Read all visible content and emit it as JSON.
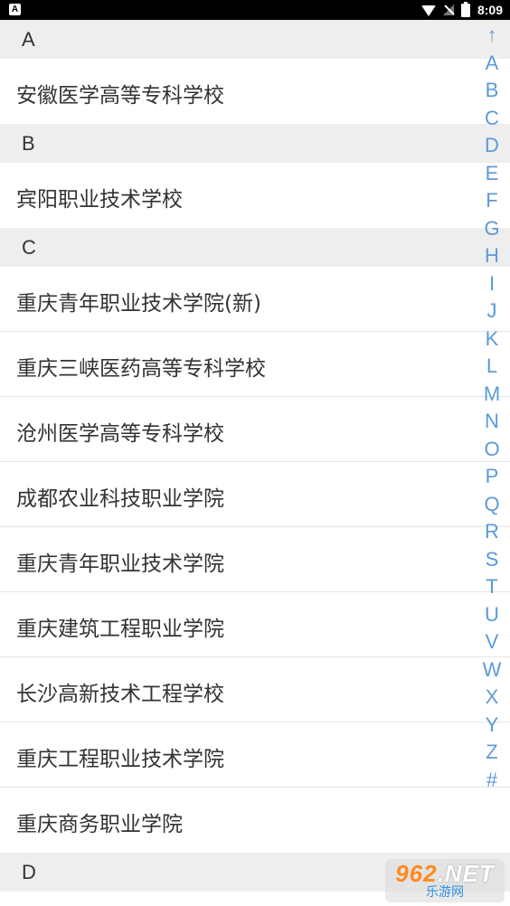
{
  "status_bar": {
    "notification_badge": "A",
    "time": "8:09",
    "icons": [
      "wifi-icon",
      "signal-off-icon",
      "battery-charging-icon"
    ]
  },
  "sections": [
    {
      "letter": "A",
      "items": [
        "安徽医学高等专科学校"
      ]
    },
    {
      "letter": "B",
      "items": [
        "宾阳职业技术学校"
      ]
    },
    {
      "letter": "C",
      "items": [
        "重庆青年职业技术学院(新)",
        "重庆三峡医药高等专科学校",
        "沧州医学高等专科学校",
        "成都农业科技职业学院",
        "重庆青年职业技术学院",
        "重庆建筑工程职业学院",
        "长沙高新技术工程学校",
        "重庆工程职业技术学院",
        "重庆商务职业学院"
      ]
    },
    {
      "letter": "D",
      "items": []
    }
  ],
  "index_bar": [
    "↑",
    "A",
    "B",
    "C",
    "D",
    "E",
    "F",
    "G",
    "H",
    "I",
    "J",
    "K",
    "L",
    "M",
    "N",
    "O",
    "P",
    "Q",
    "R",
    "S",
    "T",
    "U",
    "V",
    "W",
    "X",
    "Y",
    "Z",
    "#"
  ],
  "colors": {
    "accent": "#5b9bd8",
    "header_bg": "#eeeeee",
    "text": "#333333"
  },
  "watermark": {
    "top": "962",
    "top_suffix": ".NET",
    "bottom": "乐游网"
  }
}
